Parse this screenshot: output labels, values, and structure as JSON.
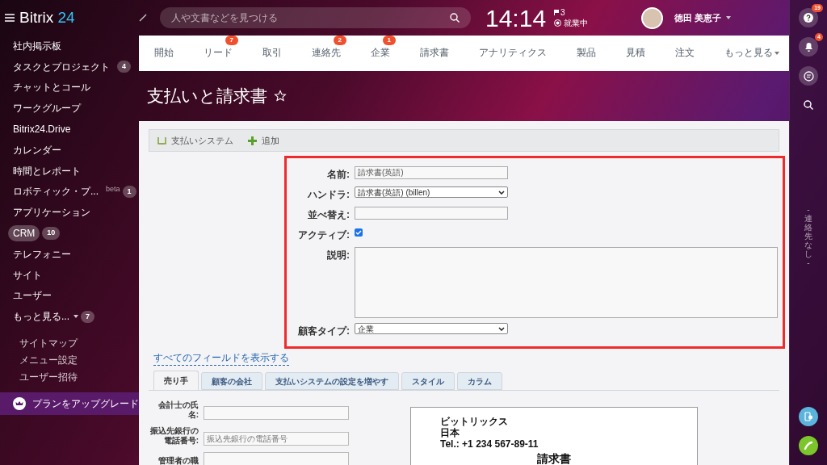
{
  "header": {
    "logo": {
      "text": "Bitrix",
      "accent": "24"
    },
    "search": {
      "placeholder": "人や文書などを見つける"
    },
    "clock": "14:14",
    "flag_count": "3",
    "work_status": "就業中",
    "user_name": "徳田 美恵子"
  },
  "sidebar": {
    "items": [
      {
        "label": "社内掲示板",
        "selected": false
      },
      {
        "label": "タスクとプロジェクト",
        "counter": "4",
        "selected": false
      },
      {
        "label": "チャットとコール",
        "selected": false
      },
      {
        "label": "ワークグループ",
        "selected": false
      },
      {
        "label": "Bitrix24.Drive",
        "selected": false
      },
      {
        "label": "カレンダー",
        "selected": false
      },
      {
        "label": "時間とレポート",
        "selected": false
      },
      {
        "label": "ロボティック・プ...",
        "tag": "beta",
        "counter": "1",
        "selected": false
      },
      {
        "label": "アプリケーション",
        "selected": false
      },
      {
        "label": "CRM",
        "counter": "10",
        "selected": true
      },
      {
        "label": "テレフォニー",
        "selected": false
      },
      {
        "label": "サイト",
        "selected": false
      },
      {
        "label": "ユーザー",
        "selected": false
      },
      {
        "label": "もっと見る...",
        "counter": "7",
        "selected": false,
        "dropdown": true
      }
    ],
    "footer_links": [
      "サイトマップ",
      "メニュー設定",
      "ユーザー招待"
    ],
    "upgrade": "プランをアップグレード"
  },
  "nav_tabs": [
    {
      "label": "開始"
    },
    {
      "label": "リード",
      "badge": "7"
    },
    {
      "label": "取引"
    },
    {
      "label": "連絡先",
      "badge": "2"
    },
    {
      "label": "企業",
      "badge": "1"
    },
    {
      "label": "請求書"
    },
    {
      "label": "アナリティクス"
    },
    {
      "label": "製品"
    },
    {
      "label": "見積"
    },
    {
      "label": "注文"
    },
    {
      "label": "もっと見る",
      "dropdown": true
    }
  ],
  "page_title": "支払いと請求書",
  "toolbar": [
    {
      "kind": "list",
      "label": "支払いシステム"
    },
    {
      "kind": "add",
      "label": "追加"
    }
  ],
  "form": {
    "highlighted": true,
    "fields": [
      {
        "kind": "text",
        "label": "名前:",
        "value": "請求書(英語)"
      },
      {
        "kind": "select",
        "label": "ハンドラ:",
        "value": "請求書(英語) (billen)"
      },
      {
        "kind": "text",
        "label": "並べ替え:"
      },
      {
        "kind": "checkbox",
        "label": "アクティブ:",
        "checked": true
      },
      {
        "kind": "textarea",
        "label": "説明:"
      },
      {
        "kind": "select",
        "label": "顧客タイプ:",
        "value": "企業"
      }
    ]
  },
  "show_all_link": "すべてのフィールドを表示する",
  "tabs": [
    {
      "label": "売り手",
      "selected": true
    },
    {
      "label": "顧客の会社",
      "selected": false
    },
    {
      "label": "支払いシステムの設定を増やす",
      "selected": false
    },
    {
      "label": "スタイル",
      "selected": false
    },
    {
      "label": "カラム",
      "selected": false
    }
  ],
  "seller_fields": [
    {
      "label": "会計士の氏名:"
    },
    {
      "label": "振込先銀行の電話番号:",
      "placeholder": "振込先銀行の電話番号"
    },
    {
      "label": "管理者の職"
    }
  ],
  "invoice_preview": {
    "lines": [
      "ビットリックス",
      "日本",
      "Tel.: +1 234 567-89-11"
    ],
    "title": "請求書"
  },
  "right_bar": {
    "help_badge": "19",
    "notification_badge": "4",
    "vertical_text": "- 連絡先なし -"
  }
}
